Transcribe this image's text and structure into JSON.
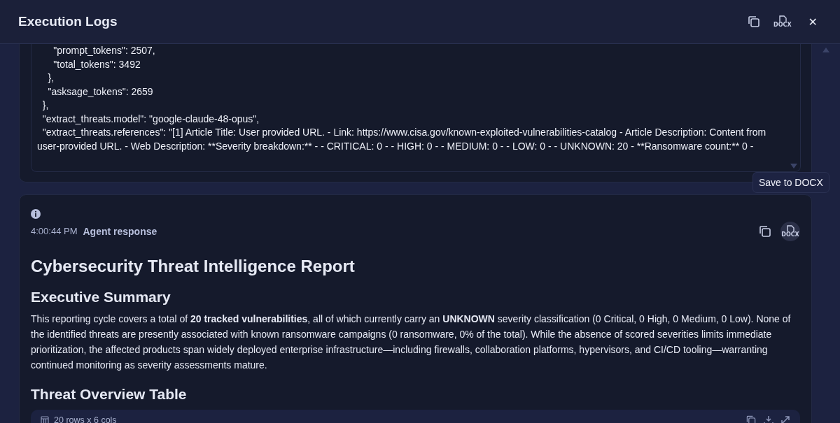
{
  "window": {
    "title": "Execution Logs"
  },
  "header_actions": [
    {
      "kind": "copy"
    },
    {
      "kind": "docx",
      "label": "DOCX"
    },
    {
      "kind": "close",
      "label": "✕"
    }
  ],
  "log_lines": [
    "      \"prompt_tokens\": 2507,",
    "      \"total_tokens\": 3492",
    "    },",
    "    \"asksage_tokens\": 2659",
    "  },",
    "  \"extract_threats.model\": \"google-claude-48-opus\",",
    "  \"extract_threats.references\": \"[1] Article Title: User provided URL. - Link: https://www.cisa.gov/known-exploited-vulnerabilities-catalog - Article Description: Content from user-provided URL. - Web Description: **Severity breakdown:** - - CRITICAL: 0 - - HIGH: 0 - - MEDIUM: 0 - - LOW: 0 - - UNKNOWN: 20 - **Ransomware count:** 0 -"
  ],
  "response": {
    "time": "4:00:44 PM",
    "label": "Agent response",
    "actions": [
      {
        "kind": "copy"
      },
      {
        "kind": "docx",
        "label": "DOCX"
      }
    ],
    "tooltip": "Save to DOCX",
    "title": "Cybersecurity Threat Intelligence Report",
    "sections": [
      {
        "heading": "Executive Summary",
        "paragraph": "This reporting cycle covers a total of **20 tracked vulnerabilities**, all of which currently carry an **UNKNOWN** severity classification (0 Critical, 0 High, 0 Medium, 0 Low). None of the identified threats are presently associated with known ransomware campaigns (0 ransomware, 0% of the total). While the absence of scored severities limits immediate prioritization, the affected products span widely deployed enterprise infrastructure—including firewalls, collaboration platforms, hypervisors, and CI/CD tooling—warranting continued monitoring as severity assessments mature."
      },
      {
        "heading": "Threat Overview Table"
      }
    ],
    "table": {
      "summary": "20 rows x 6 cols",
      "actions": [
        {
          "kind": "copy"
        },
        {
          "kind": "download"
        },
        {
          "kind": "expand"
        }
      ]
    }
  }
}
